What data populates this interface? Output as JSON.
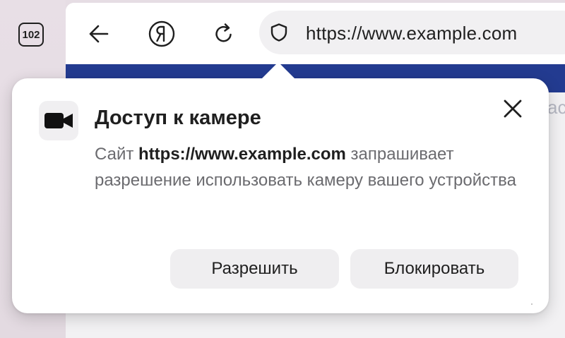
{
  "tabs": {
    "count": "102"
  },
  "toolbar": {
    "back_icon": "arrow-left-icon",
    "yandex_icon": "yandex-logo-icon",
    "reload_icon": "reload-icon",
    "security_icon": "shield-icon",
    "url": "https://www.example.com"
  },
  "page": {
    "banner_color": "#233b90",
    "peek_text": "ас"
  },
  "popup": {
    "icon": "video-camera-icon",
    "title": "Доступ к камере",
    "body_prefix": "Сайт ",
    "body_site": "https://www.example.com",
    "body_suffix": " запрашивает разрешение использовать камеру вашего устройства",
    "close_icon": "close-icon",
    "allow_label": "Разрешить",
    "block_label": "Блокировать"
  }
}
